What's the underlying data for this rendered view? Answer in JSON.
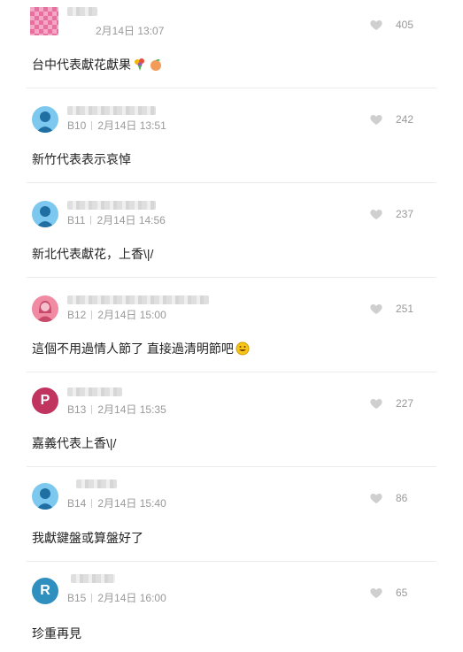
{
  "comments": [
    {
      "floor": "",
      "time": "2月14日 13:07",
      "likes": "405",
      "text": "台中代表獻花獻果",
      "avatar": "pixel"
    },
    {
      "floor": "B10",
      "time": "2月14日 13:51",
      "likes": "242",
      "text": "新竹代表表示哀悼",
      "avatar": "default"
    },
    {
      "floor": "B11",
      "time": "2月14日 14:56",
      "likes": "237",
      "text": "新北代表獻花，上香\\|/",
      "avatar": "default"
    },
    {
      "floor": "B12",
      "time": "2月14日 15:00",
      "likes": "251",
      "text": "這個不用過情人節了 直接過清明節吧",
      "avatar": "female"
    },
    {
      "floor": "B13",
      "time": "2月14日 15:35",
      "likes": "227",
      "text": "嘉義代表上香\\|/",
      "avatar": "letter",
      "avatar_letter": "P",
      "avatar_color": "#c0345f"
    },
    {
      "floor": "B14",
      "time": "2月14日 15:40",
      "likes": "86",
      "text": "我獻鍵盤或算盤好了",
      "avatar": "default"
    },
    {
      "floor": "B15",
      "time": "2月14日 16:00",
      "likes": "65",
      "text": "珍重再見",
      "avatar": "letter",
      "avatar_letter": "R",
      "avatar_color": "#2f8fbf"
    }
  ],
  "colors": {
    "heart": "#cfcfcf",
    "meta": "#999999",
    "divider": "#ececec"
  },
  "icons": {
    "like": "heart-icon",
    "default_avatar": "user-silhouette-icon"
  }
}
